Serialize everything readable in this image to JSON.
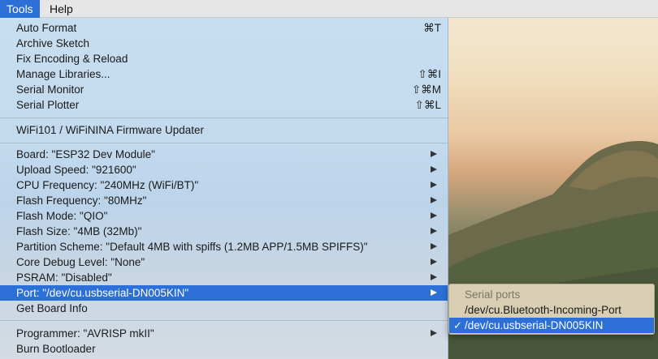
{
  "menubar": {
    "tools": "Tools",
    "help": "Help"
  },
  "tools_menu": {
    "auto_format": {
      "label": "Auto Format",
      "shortcut": "⌘T"
    },
    "archive_sketch": {
      "label": "Archive Sketch"
    },
    "fix_encoding": {
      "label": "Fix Encoding & Reload"
    },
    "manage_libraries": {
      "label": "Manage Libraries...",
      "shortcut": "⇧⌘I"
    },
    "serial_monitor": {
      "label": "Serial Monitor",
      "shortcut": "⇧⌘M"
    },
    "serial_plotter": {
      "label": "Serial Plotter",
      "shortcut": "⇧⌘L"
    },
    "firmware_updater": {
      "label": "WiFi101 / WiFiNINA Firmware Updater"
    },
    "board": {
      "label": "Board: \"ESP32 Dev Module\""
    },
    "upload_speed": {
      "label": "Upload Speed: \"921600\""
    },
    "cpu_frequency": {
      "label": "CPU Frequency: \"240MHz (WiFi/BT)\""
    },
    "flash_frequency": {
      "label": "Flash Frequency: \"80MHz\""
    },
    "flash_mode": {
      "label": "Flash Mode: \"QIO\""
    },
    "flash_size": {
      "label": "Flash Size: \"4MB (32Mb)\""
    },
    "partition_scheme": {
      "label": "Partition Scheme: \"Default 4MB with spiffs (1.2MB APP/1.5MB SPIFFS)\""
    },
    "core_debug": {
      "label": "Core Debug Level: \"None\""
    },
    "psram": {
      "label": "PSRAM: \"Disabled\""
    },
    "port": {
      "label": "Port: \"/dev/cu.usbserial-DN005KIN\""
    },
    "get_board_info": {
      "label": "Get Board Info"
    },
    "programmer": {
      "label": "Programmer: \"AVRISP mkII\""
    },
    "burn_bootloader": {
      "label": "Burn Bootloader"
    }
  },
  "port_submenu": {
    "header": "Serial ports",
    "items": [
      "/dev/cu.Bluetooth-Incoming-Port",
      "/dev/cu.usbserial-DN005KIN"
    ],
    "selected_check": "✓"
  },
  "colors": {
    "highlight": "#2c6fd6",
    "menu_bg": "#c4dbef"
  }
}
